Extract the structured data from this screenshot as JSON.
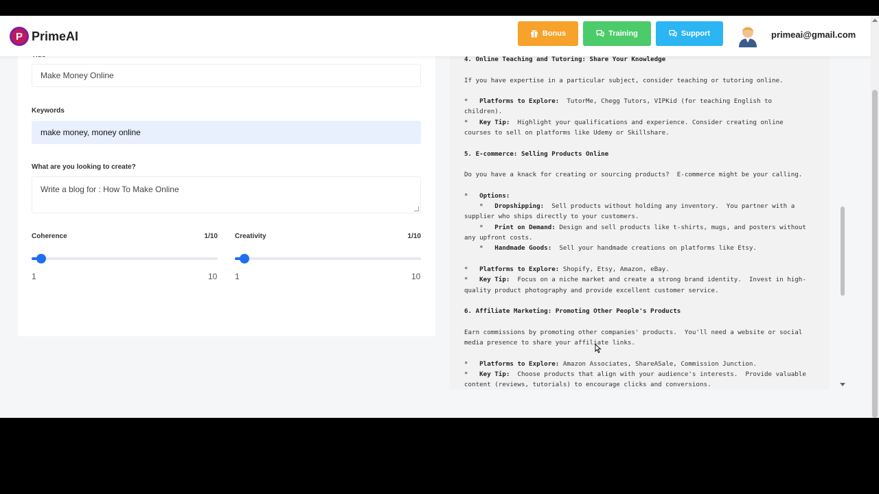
{
  "app": {
    "logo_letter": "P",
    "name": "PrimeAI"
  },
  "header": {
    "bonus_label": "Bonus",
    "training_label": "Training",
    "support_label": "Support",
    "user_email": "primeai@gmail.com",
    "colors": {
      "bonus": "#f7a22a",
      "training": "#4ccb6a",
      "support": "#2bb5f3"
    }
  },
  "form": {
    "title_label": "Title",
    "title_value": "Make Money Online",
    "keywords_label": "Keywords",
    "keywords_value": "make money, money online",
    "create_label": "What are you looking to create?",
    "create_value": "Write a blog for : How To Make Online",
    "coherence": {
      "label": "Coherence",
      "display": "1/10",
      "value": 1,
      "min": 1,
      "max": 10,
      "min_label": "1",
      "max_label": "10"
    },
    "creativity": {
      "label": "Creativity",
      "display": "1/10",
      "value": 1,
      "min": 1,
      "max": 10,
      "min_label": "1",
      "max_label": "10"
    }
  },
  "output": {
    "lines": [
      {
        "t": "4. Online Teaching and Tutoring: Share Your Knowledge",
        "b": true
      },
      {
        "t": ""
      },
      {
        "t": "If you have expertise in a particular subject, consider teaching or tutoring online."
      },
      {
        "t": ""
      },
      {
        "p": "*   ",
        "bt": "Platforms to Explore:",
        "t": "  TutorMe, Chegg Tutors, VIPKid (for teaching English to"
      },
      {
        "t": "children)."
      },
      {
        "p": "*   ",
        "bt": "Key Tip:",
        "t": "  Highlight your qualifications and experience. Consider creating online"
      },
      {
        "t": "courses to sell on platforms like Udemy or Skillshare."
      },
      {
        "t": ""
      },
      {
        "t": "5. E-commerce: Selling Products Online",
        "b": true
      },
      {
        "t": ""
      },
      {
        "t": "Do you have a knack for creating or sourcing products?  E-commerce might be your calling."
      },
      {
        "t": ""
      },
      {
        "p": "*   ",
        "bt": "Options:",
        "t": ""
      },
      {
        "p": "    *   ",
        "bt": "Dropshipping:",
        "t": "  Sell products without holding any inventory.  You partner with a"
      },
      {
        "t": "supplier who ships directly to your customers."
      },
      {
        "p": "    *   ",
        "bt": "Print on Demand:",
        "t": " Design and sell products like t-shirts, mugs, and posters without"
      },
      {
        "t": "any upfront costs."
      },
      {
        "p": "    *   ",
        "bt": "Handmade Goods:",
        "t": "  Sell your handmade creations on platforms like Etsy."
      },
      {
        "t": ""
      },
      {
        "p": "*   ",
        "bt": "Platforms to Explore:",
        "t": " Shopify, Etsy, Amazon, eBay."
      },
      {
        "p": "*   ",
        "bt": "Key Tip:",
        "t": "  Focus on a niche market and create a strong brand identity.  Invest in high-"
      },
      {
        "t": "quality product photography and provide excellent customer service."
      },
      {
        "t": ""
      },
      {
        "t": "6. Affiliate Marketing: Promoting Other People's Products",
        "b": true
      },
      {
        "t": ""
      },
      {
        "t": "Earn commissions by promoting other companies' products.  You'll need a website or social"
      },
      {
        "t": "media presence to share your affiliate links."
      },
      {
        "t": ""
      },
      {
        "p": "*   ",
        "bt": "Platforms to Explore:",
        "t": " Amazon Associates, ShareASale, Commission Junction."
      },
      {
        "p": "*   ",
        "bt": "Key Tip:",
        "t": "  Choose products that align with your audience's interests.  Provide valuable"
      },
      {
        "t": "content (reviews, tutorials) to encourage clicks and conversions."
      }
    ]
  },
  "icons": {
    "bonus": "gift-icon",
    "training": "chat-icon",
    "support": "chat-icon",
    "avatar": "user-avatar",
    "scroll_down": "scroll-down-arrow"
  }
}
